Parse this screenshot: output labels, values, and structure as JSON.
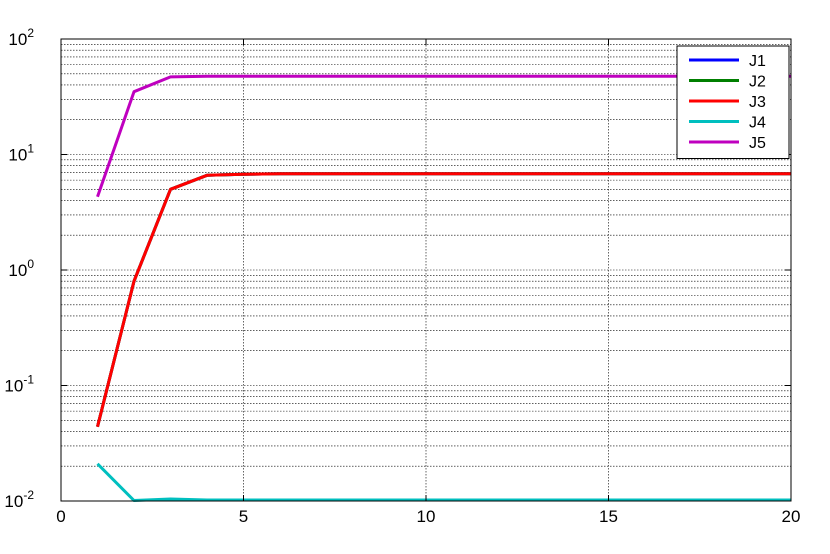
{
  "chart_data": {
    "type": "line",
    "title": "",
    "xlabel": "",
    "ylabel": "",
    "xlim": [
      0,
      20
    ],
    "ylim": [
      0.01,
      100
    ],
    "yscale": "log",
    "grid": true,
    "legend_position": "top-right",
    "x_ticks": [
      "0",
      "5",
      "10",
      "15",
      "20"
    ],
    "y_ticks": [
      {
        "base": "10",
        "exp": "-2"
      },
      {
        "base": "10",
        "exp": "-1"
      },
      {
        "base": "10",
        "exp": "0"
      },
      {
        "base": "10",
        "exp": "1"
      },
      {
        "base": "10",
        "exp": "2"
      }
    ],
    "x": [
      1,
      2,
      3,
      4,
      5,
      6,
      7,
      8,
      9,
      10,
      11,
      12,
      13,
      14,
      15,
      16,
      17,
      18,
      19,
      20
    ],
    "series": [
      {
        "name": "J1",
        "color": "#0000ff",
        "values": [
          0.044,
          0.8,
          5.0,
          6.6,
          6.75,
          6.8,
          6.8,
          6.8,
          6.8,
          6.8,
          6.8,
          6.8,
          6.8,
          6.8,
          6.8,
          6.8,
          6.8,
          6.8,
          6.8,
          6.8
        ]
      },
      {
        "name": "J2",
        "color": "#007f00",
        "values": [
          0.044,
          0.8,
          5.0,
          6.6,
          6.75,
          6.8,
          6.8,
          6.8,
          6.8,
          6.8,
          6.8,
          6.8,
          6.8,
          6.8,
          6.8,
          6.8,
          6.8,
          6.8,
          6.8,
          6.8
        ]
      },
      {
        "name": "J3",
        "color": "#ff0000",
        "values": [
          0.044,
          0.8,
          5.0,
          6.6,
          6.75,
          6.8,
          6.8,
          6.8,
          6.8,
          6.8,
          6.8,
          6.8,
          6.8,
          6.8,
          6.8,
          6.8,
          6.8,
          6.8,
          6.8,
          6.8
        ]
      },
      {
        "name": "J4",
        "color": "#00bfbf",
        "values": [
          0.021,
          0.0101,
          0.0104,
          0.0102,
          0.0102,
          0.0102,
          0.0102,
          0.0102,
          0.0102,
          0.0102,
          0.0102,
          0.0102,
          0.0102,
          0.0102,
          0.0102,
          0.0102,
          0.0102,
          0.0102,
          0.0102,
          0.0102
        ]
      },
      {
        "name": "J5",
        "color": "#bf00bf",
        "values": [
          4.3,
          35,
          47,
          47.5,
          47.5,
          47.5,
          47.5,
          47.5,
          47.5,
          47.5,
          47.5,
          47.5,
          47.5,
          47.5,
          47.5,
          47.5,
          47.5,
          47.5,
          47.5,
          47.5
        ]
      }
    ]
  }
}
